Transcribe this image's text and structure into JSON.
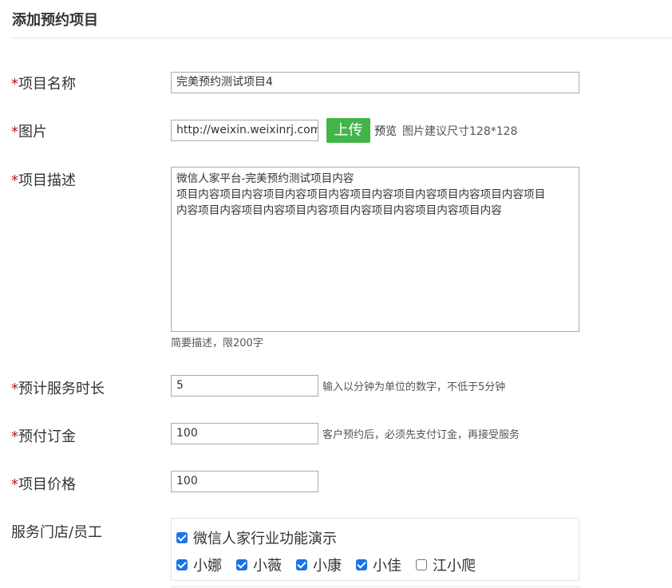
{
  "page": {
    "title": "添加预约项目"
  },
  "form": {
    "required_mark": "*",
    "name": {
      "label": "项目名称",
      "value": "完美预约测试项目4"
    },
    "image": {
      "label": "图片",
      "value": "http://weixin.weixinrj.com",
      "upload_button": "上传",
      "preview_link": "预览",
      "hint": "图片建议尺寸128*128"
    },
    "description": {
      "label": "项目描述",
      "lines": [
        "微信人家平台-完美预约测试项目内容",
        "项目内容项目内容项目内容项目内容项目内容项目内容项目内容项目内容项目",
        "内容项目内容项目内容项目内容项目内容项目内容项目内容项目内容"
      ],
      "hint": "简要描述，限200字"
    },
    "duration": {
      "label": "预计服务时长",
      "value": "5",
      "hint": "输入以分钟为单位的数字，不低于5分钟"
    },
    "deposit": {
      "label": "预付订金",
      "value": "100",
      "hint": "客户预约后，必须先支付订金，再接受服务"
    },
    "price": {
      "label": "项目价格",
      "value": "100"
    },
    "stores": {
      "label": "服务门店/员工",
      "store": {
        "name": "微信人家行业功能演示",
        "checked": true
      },
      "staff": [
        {
          "name": "小娜",
          "checked": true
        },
        {
          "name": "小薇",
          "checked": true
        },
        {
          "name": "小康",
          "checked": true
        },
        {
          "name": "小佳",
          "checked": true
        },
        {
          "name": "江小爬",
          "checked": false
        }
      ]
    }
  },
  "colors": {
    "required": "#b0181b",
    "upload_button": "#44b549",
    "checkbox": "#1a73e8"
  }
}
